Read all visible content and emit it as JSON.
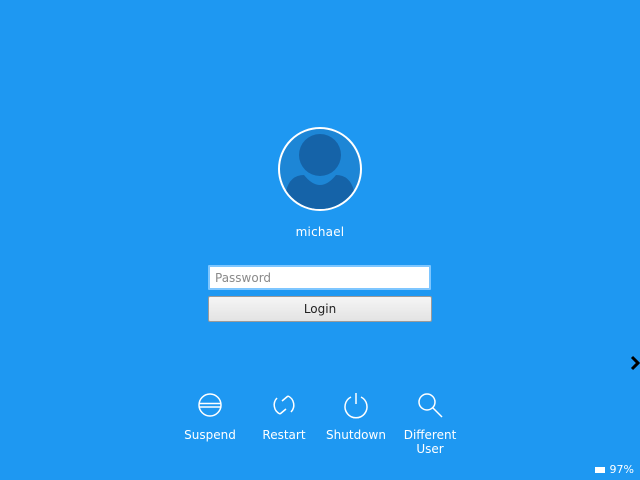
{
  "user": {
    "name": "michael"
  },
  "login_form": {
    "password_placeholder": "Password",
    "login_label": "Login"
  },
  "actions": [
    {
      "label": "Suspend",
      "icon": "suspend-icon"
    },
    {
      "label": "Restart",
      "icon": "restart-icon"
    },
    {
      "label": "Shutdown",
      "icon": "power-icon"
    },
    {
      "label": "Different User",
      "icon": "search-icon"
    }
  ],
  "status": {
    "battery": "97%",
    "battery_icon": "battery-icon"
  },
  "colors": {
    "background": "#1e98f2",
    "avatar_fill": "#1d86d6",
    "avatar_figure": "#1563a8"
  }
}
